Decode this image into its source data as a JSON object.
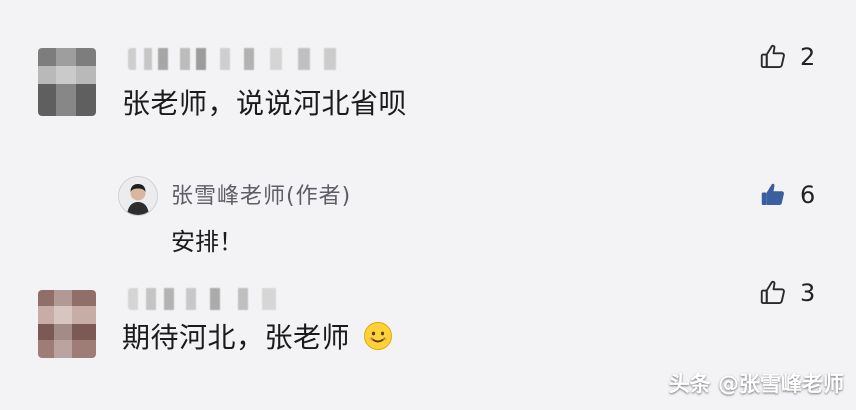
{
  "comments": [
    {
      "text": "张老师，说说河北省呗",
      "likes": "2",
      "liked": false,
      "reply": {
        "author": "张雪峰老师(作者)",
        "text": "安排！",
        "likes": "6",
        "liked": true
      }
    },
    {
      "text": "期待河北，张老师",
      "likes": "3",
      "liked": false
    }
  ],
  "watermark": "头条 @张雪峰老师",
  "colors": {
    "background": "#f3f3f6",
    "liked_thumb": "#3b5e9f",
    "text": "#1b1b1b",
    "author_name": "#5e5e66"
  },
  "icons": {
    "like": "thumbs-up-icon",
    "emoji": "smiling-face-emoji"
  }
}
